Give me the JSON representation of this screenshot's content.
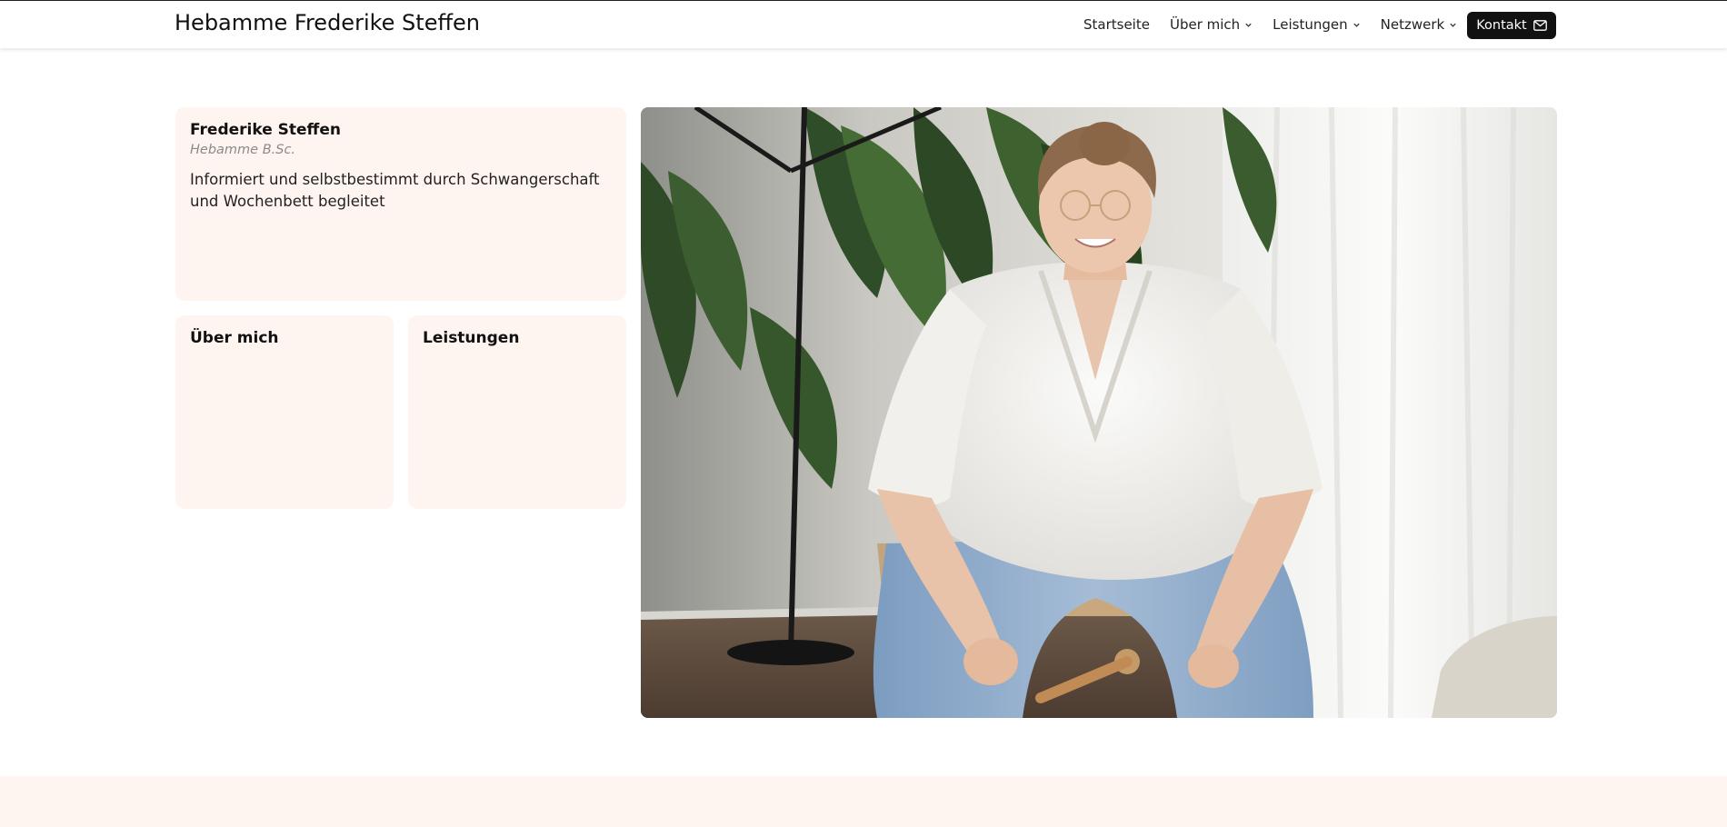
{
  "header": {
    "brand": "Hebamme Frederike Steffen",
    "nav": [
      {
        "label": "Startseite",
        "has_dropdown": false
      },
      {
        "label": "Über mich",
        "has_dropdown": true
      },
      {
        "label": "Leistungen",
        "has_dropdown": true
      },
      {
        "label": "Netzwerk",
        "has_dropdown": true
      }
    ],
    "contact_label": "Kontakt",
    "contact_icon": "mail-icon"
  },
  "intro_card": {
    "name": "Frederike Steffen",
    "subtitle": "Hebamme B.Sc.",
    "text": "Informiert und selbstbestimmt durch Schwangerschaft und Wochenbett begleitet"
  },
  "cards": {
    "about_title": "Über mich",
    "services_title": "Leistungen"
  },
  "colors": {
    "card_bg": "#fff5f0",
    "button_bg": "#111111",
    "band_bg": "#fff5f0"
  }
}
